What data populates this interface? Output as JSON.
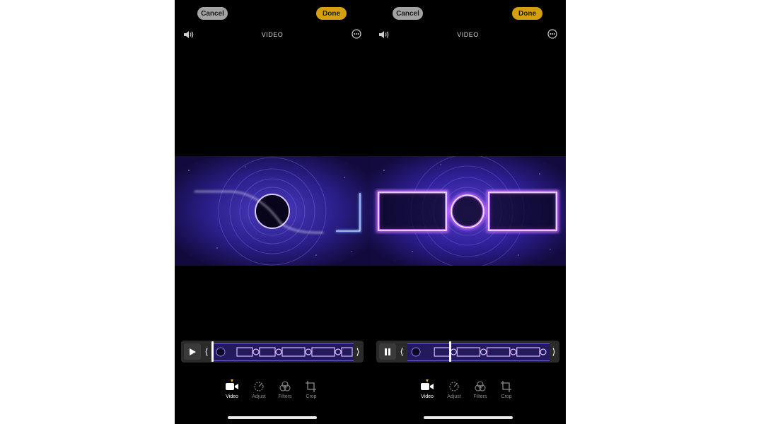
{
  "panels": [
    {
      "id": "left",
      "cancel_label": "Cancel",
      "done_label": "Done",
      "mode_title": "VIDEO",
      "playback_state": "paused",
      "playhead_fraction": 0.0,
      "tools": [
        {
          "label": "Video",
          "icon": "video-camera-icon",
          "active": true
        },
        {
          "label": "Adjust",
          "icon": "adjust-dial-icon",
          "active": false
        },
        {
          "label": "Filters",
          "icon": "filters-icon",
          "active": false
        },
        {
          "label": "Crop",
          "icon": "crop-icon",
          "active": false
        }
      ]
    },
    {
      "id": "right",
      "cancel_label": "Cancel",
      "done_label": "Done",
      "mode_title": "VIDEO",
      "playback_state": "playing",
      "playhead_fraction": 0.3,
      "tools": [
        {
          "label": "Video",
          "icon": "video-camera-icon",
          "active": true
        },
        {
          "label": "Adjust",
          "icon": "adjust-dial-icon",
          "active": false
        },
        {
          "label": "Filters",
          "icon": "filters-icon",
          "active": false
        },
        {
          "label": "Crop",
          "icon": "crop-icon",
          "active": false
        }
      ]
    }
  ],
  "colors": {
    "done_button": "#d4a00f",
    "cancel_button": "#a3a3a3",
    "active_dot": "#f5c518",
    "neon_purple": "#b86bff",
    "neon_blue": "#5a8cff",
    "video_bg": "#1a1060"
  }
}
